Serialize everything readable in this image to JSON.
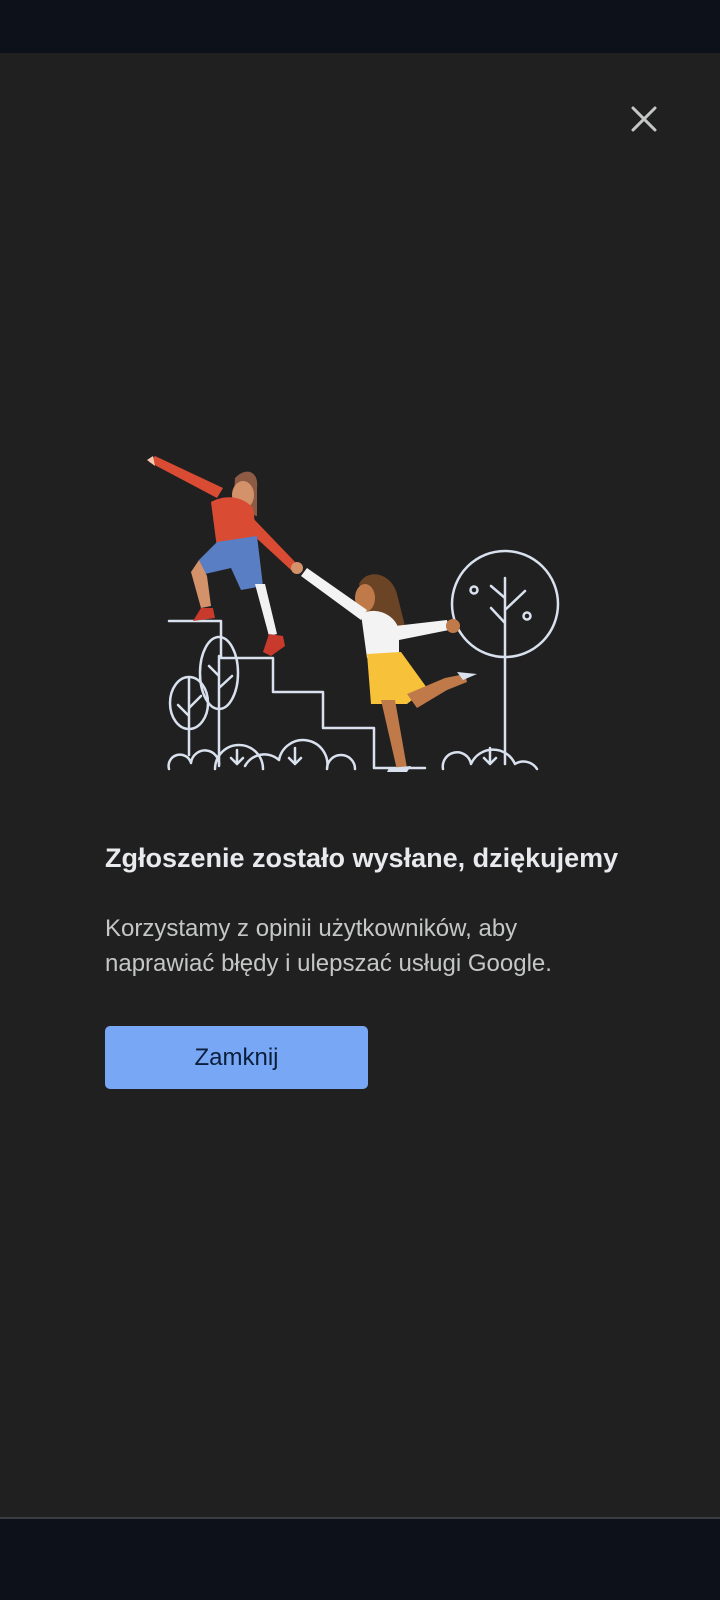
{
  "dialog": {
    "title": "Zgłoszenie zostało wysłane, dziękujemy",
    "message": "Korzystamy z opinii użytkowników, aby naprawiać błędy i ulepszać usługi Google.",
    "close_button_label": "Zamknij",
    "close_icon": "close-icon"
  },
  "illustration": {
    "subject": "people-climbing-stairs-illustration"
  },
  "colors": {
    "background": "#202020",
    "system_bars": "#0d1119",
    "primary_button": "#78a7f6",
    "title_text": "#e8eaed",
    "body_text": "#c4c7c5",
    "line_art": "#d9e1ee"
  }
}
